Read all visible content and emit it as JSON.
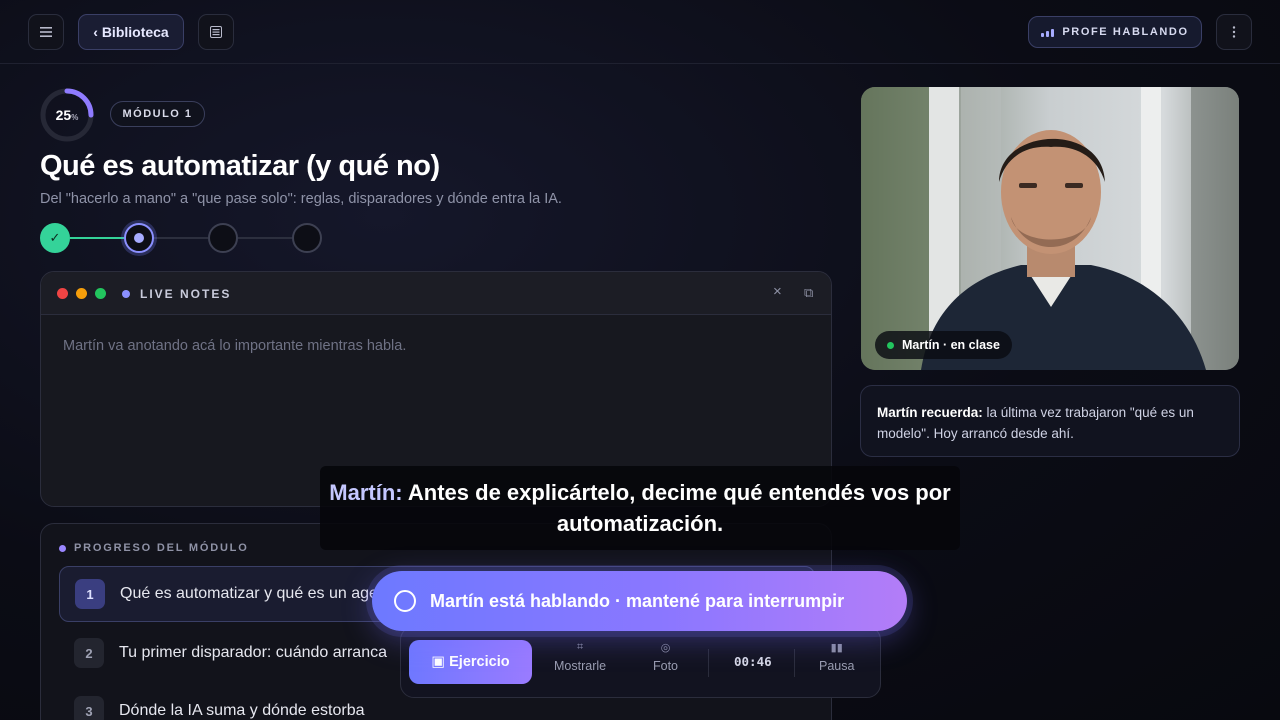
{
  "topbar": {
    "menu_icon": "menu-icon",
    "library_label": "‹ Biblioteca",
    "notes_icon": "list-icon",
    "status_badge": "PROFE HABLANDO",
    "more_icon": "more-vertical-icon"
  },
  "lesson": {
    "progress_value": "25",
    "progress_unit": "%",
    "progress_fraction": 0.25,
    "module_badge": "MÓDULO 1",
    "title": "Qué es automatizar (y qué no)",
    "subtitle": "Del \"hacerlo a mano\" a \"que pase solo\": reglas, disparadores y dónde entra la IA.",
    "steps": [
      {
        "state": "done",
        "glyph": "✓"
      },
      {
        "state": "current",
        "glyph": ""
      },
      {
        "state": "pending",
        "glyph": ""
      },
      {
        "state": "pending",
        "glyph": ""
      }
    ]
  },
  "notes": {
    "title": "LIVE NOTES",
    "close_icon": "×",
    "popout_icon": "⧉",
    "placeholder": "Martín va anotando acá lo importante mientras habla.",
    "dot_colors": [
      "#ef4444",
      "#f59e0b",
      "#22c55e"
    ]
  },
  "module_progress": {
    "title": "PROGRESO DEL MÓDULO",
    "items": [
      {
        "num": "1",
        "label": "Qué es automatizar y qué es un agente"
      },
      {
        "num": "2",
        "label": "Tu primer disparador: cuándo arranca"
      },
      {
        "num": "3",
        "label": "Dónde la IA suma y dónde estorba"
      }
    ]
  },
  "video": {
    "caption": "Martín · en clase"
  },
  "recall": {
    "name": "Martín recuerda:",
    "text": " la última vez trabajaron \"qué es un modelo\". Hoy arrancó desde ahí."
  },
  "caption": {
    "speaker": "Martín:",
    "text": " Antes de explicártelo, decime qué entendés vos por automatización."
  },
  "speaking_bar": {
    "label": "Martín está hablando · mantené para interrumpir"
  },
  "toolbar": {
    "exercise_label": "Ejercicio",
    "exercise_glyph": "▣",
    "show_label": "Mostrarle",
    "show_glyph": "⌗",
    "photo_label": "Foto",
    "photo_glyph": "◎",
    "timer": "00:46",
    "pause_label": "Pausa",
    "pause_glyph": "▮▮"
  },
  "colors": {
    "accent": "#7c7fff",
    "success": "#34d399",
    "live": "#22c55e"
  }
}
